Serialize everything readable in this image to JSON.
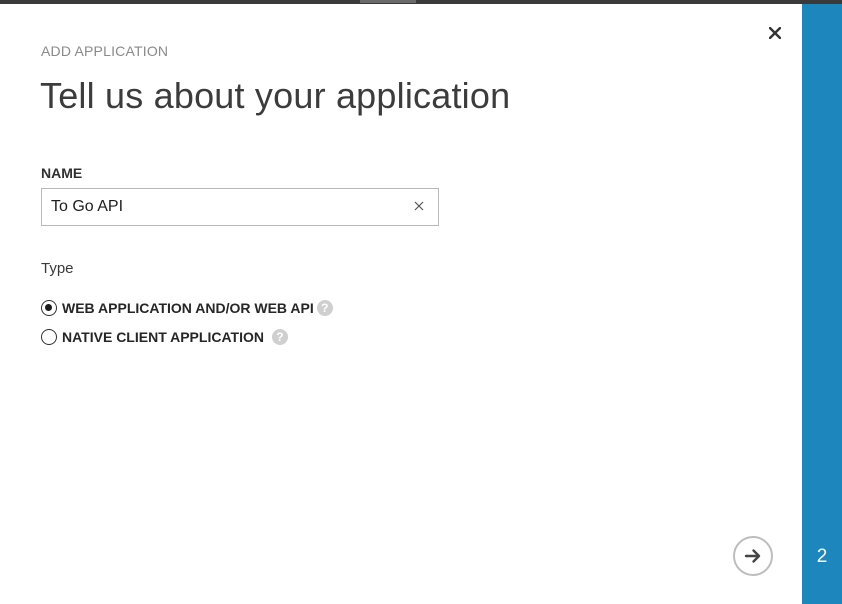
{
  "dialog": {
    "subtitle": "ADD APPLICATION",
    "title": "Tell us about your application",
    "close_icon": "close-icon"
  },
  "name_field": {
    "label": "NAME",
    "value": "To Go API",
    "clear_icon": "clear-icon"
  },
  "type_group": {
    "label": "Type",
    "options": [
      {
        "label": "WEB APPLICATION AND/OR WEB API",
        "selected": true,
        "help": "?"
      },
      {
        "label": "NATIVE CLIENT APPLICATION",
        "selected": false,
        "help": "?"
      }
    ]
  },
  "navigation": {
    "next_icon": "arrow-right-icon",
    "step_number": "2"
  },
  "colors": {
    "accent": "#1d87bd",
    "background": "#ffffff"
  }
}
